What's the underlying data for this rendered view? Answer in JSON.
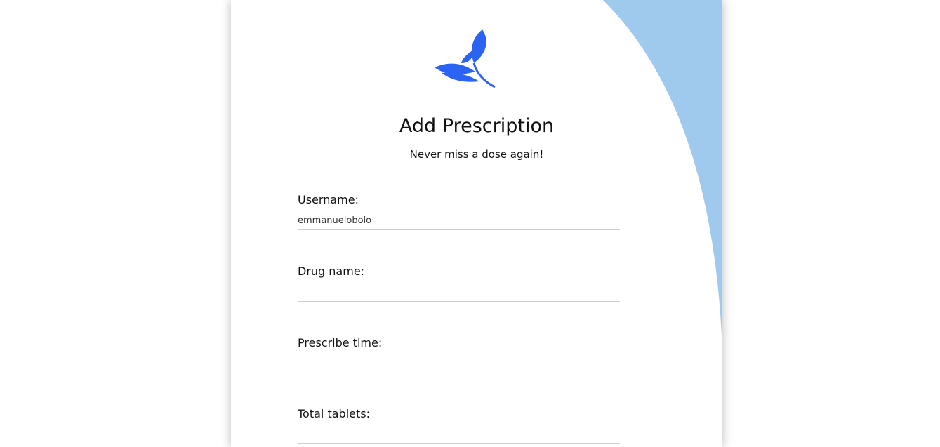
{
  "colors": {
    "accent_blue": "#2b63f2",
    "wave_blue": "#a0c9ee",
    "divider": "#cfcfcf"
  },
  "header": {
    "logo_icon": "leaf-logo-icon",
    "title": "Add Prescription",
    "subtitle": "Never miss a dose again!"
  },
  "form": {
    "fields": [
      {
        "label": "Username:",
        "value": "emmanuelobolo",
        "placeholder": ""
      },
      {
        "label": "Drug name:",
        "value": "",
        "placeholder": ""
      },
      {
        "label": "Prescribe time:",
        "value": "",
        "placeholder": ""
      },
      {
        "label": "Total tablets:",
        "value": "",
        "placeholder": ""
      }
    ]
  }
}
